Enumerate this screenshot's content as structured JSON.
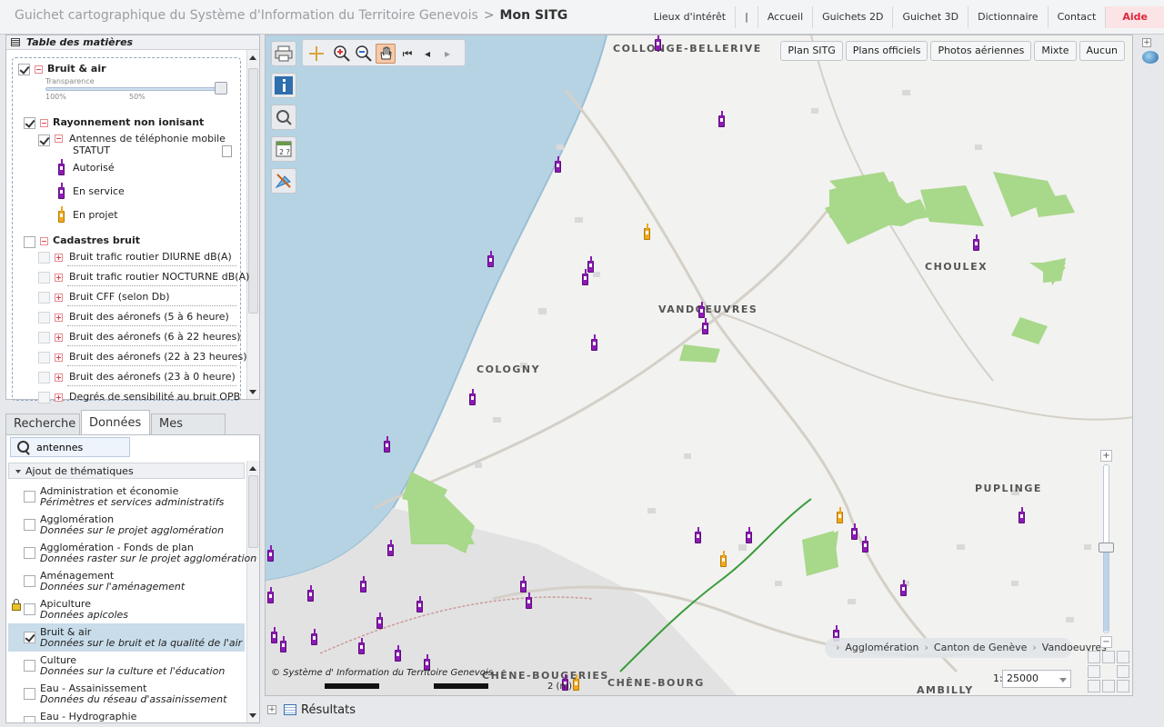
{
  "header": {
    "app_title": "Guichet cartographique du Système d'Information du Territoire Genevois",
    "separator": ">",
    "current": "Mon SITG",
    "nav": [
      "Lieux d'intérêt",
      "|",
      "Accueil",
      "Guichets 2D",
      "Guichet 3D",
      "Dictionnaire",
      "Contact",
      "Aide"
    ]
  },
  "toc": {
    "title": "Table des matières",
    "group_bruit_air": "Bruit & air",
    "transparency_label": "Transparence",
    "transparency_min": "100%",
    "transparency_mid": "50%",
    "rayonnement": "Rayonnement non ionisant",
    "antennes": "Antennes de téléphonie mobile",
    "statut": "STATUT",
    "legend": [
      "Autorisé",
      "En service",
      "En projet"
    ],
    "cadastres": "Cadastres bruit",
    "cadastre_items": [
      "Bruit trafic routier DIURNE dB(A)",
      "Bruit trafic routier NOCTURNE dB(A)",
      "Bruit CFF (selon Db)",
      "Bruit des aéronefs (5 à 6 heure)",
      "Bruit des aéronefs (6 à 22 heures)",
      "Bruit des aéronefs (22 à 23 heures)",
      "Bruit des aéronefs (23 à 0 heure)",
      "Degrés de sensibilité au bruit OPB"
    ]
  },
  "tabs": [
    "Recherche",
    "Données",
    "Mes cartes"
  ],
  "data_panel": {
    "search_value": "antennes",
    "section": "Ajout de thématiques",
    "themes": [
      {
        "title": "Administration et économie",
        "sub": "Périmètres et services administratifs"
      },
      {
        "title": "Agglomération",
        "sub": "Données sur le projet agglomération"
      },
      {
        "title": "Agglomération - Fonds de plan",
        "sub": "Données raster sur le projet agglomération"
      },
      {
        "title": "Aménagement",
        "sub": "Données sur l'aménagement"
      },
      {
        "title": "Apiculture",
        "sub": "Données apicoles"
      },
      {
        "title": "Bruit & air",
        "sub": "Données sur le bruit et la qualité de l'air"
      },
      {
        "title": "Culture",
        "sub": "Données sur la culture et l'éducation"
      },
      {
        "title": "Eau - Assainissement",
        "sub": "Données du réseau d'assainissement"
      },
      {
        "title": "Eau - Hydrographie",
        "sub": ""
      }
    ]
  },
  "map": {
    "base_layers": [
      "Plan SITG",
      "Plans officiels",
      "Photos aériennes",
      "Mixte",
      "Aucun"
    ],
    "towns": [
      "COLLONGE-BELLERIVE",
      "CHOULEX",
      "VANDOEUVRES",
      "COLOGNY",
      "PUPLINGE",
      "CHÊNE-BOUGERIES",
      "CHÊNE-BOURG",
      "AMBILLY"
    ],
    "breadcrumbs": [
      "Agglomération",
      "Canton de Genève",
      "Vandoeuvres"
    ],
    "copyright": "© Système d' Information du Territoire Genevois",
    "scale_prefix": "1:",
    "scale_value": "25000",
    "scale_label": "2 (m)",
    "zoom_level_fraction": 0.42
  },
  "results_label": "Résultats",
  "colors": {
    "authorized": "#8c1ab5",
    "in_project": "#f1a81b",
    "help": "#e0263b",
    "water": "#b6d3e4",
    "green": "#a8d88a"
  }
}
